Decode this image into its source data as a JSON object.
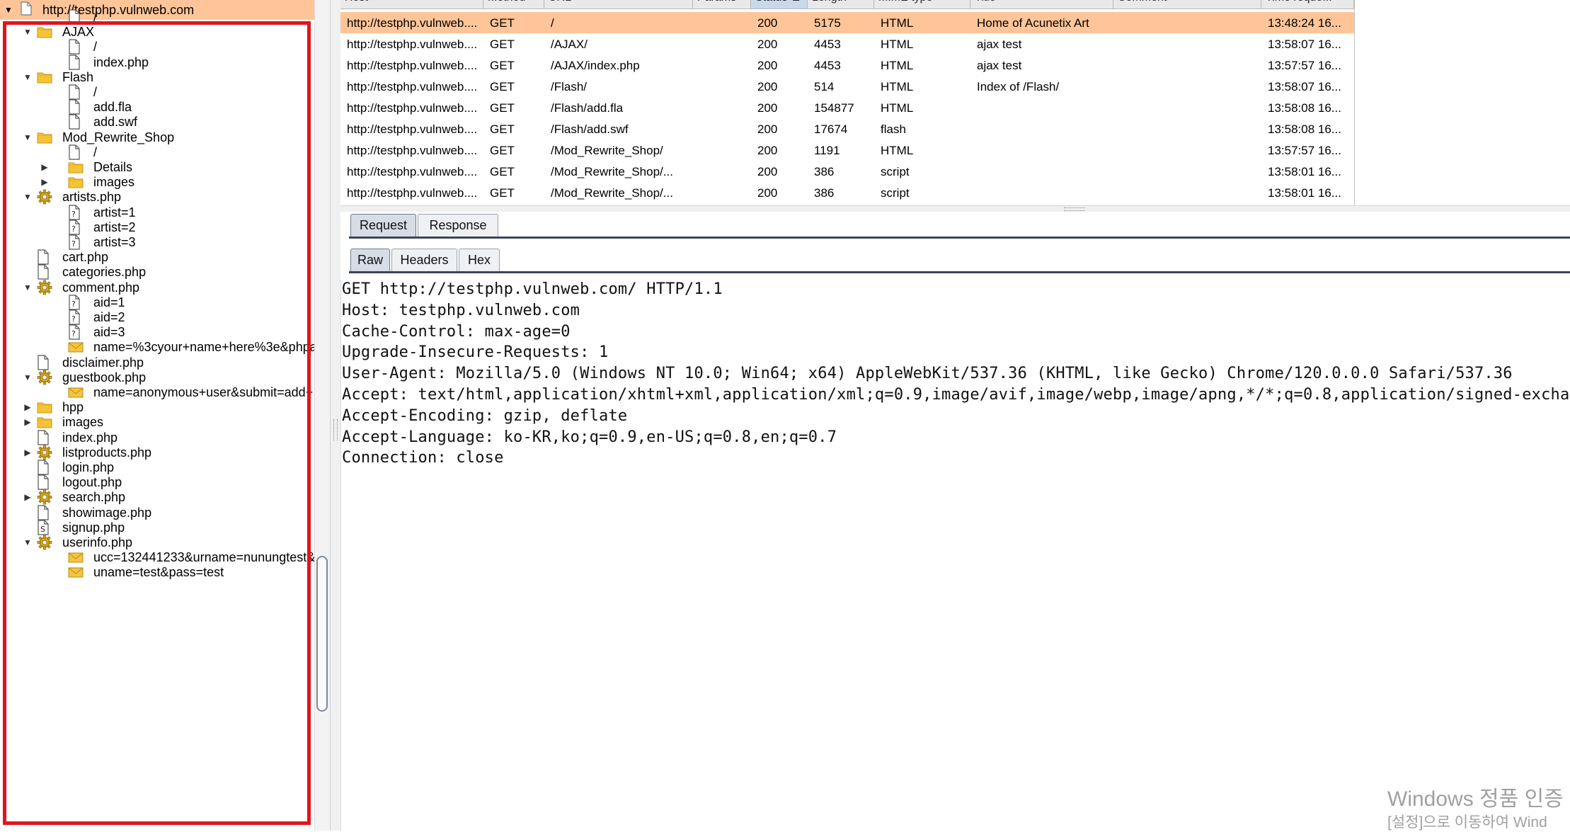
{
  "colors": {
    "selection": "#ffc599",
    "highlight_border": "#e1141e",
    "folder": "#f6c335",
    "gear": "#d4a21e",
    "envelope": "#f5c542"
  },
  "site_tree": {
    "root": {
      "label": "http://testphp.vulnweb.com",
      "icon": "document-icon"
    },
    "items": [
      {
        "label": "/",
        "icon": "file-icon",
        "level": 1,
        "toggle": ""
      },
      {
        "label": "AJAX",
        "icon": "folder-icon",
        "level": 0,
        "toggle": "▼"
      },
      {
        "label": "/",
        "icon": "file-icon",
        "level": 1,
        "toggle": ""
      },
      {
        "label": "index.php",
        "icon": "file-icon",
        "level": 1,
        "toggle": ""
      },
      {
        "label": "Flash",
        "icon": "folder-icon",
        "level": 0,
        "toggle": "▼"
      },
      {
        "label": "/",
        "icon": "file-icon",
        "level": 1,
        "toggle": ""
      },
      {
        "label": "add.fla",
        "icon": "file-icon",
        "level": 1,
        "toggle": ""
      },
      {
        "label": "add.swf",
        "icon": "file-icon",
        "level": 1,
        "toggle": ""
      },
      {
        "label": "Mod_Rewrite_Shop",
        "icon": "folder-icon",
        "level": 0,
        "toggle": "▼"
      },
      {
        "label": "/",
        "icon": "file-icon",
        "level": 1,
        "toggle": ""
      },
      {
        "label": "Details",
        "icon": "folder-icon",
        "level": 1,
        "toggle": "▶"
      },
      {
        "label": "images",
        "icon": "folder-icon",
        "level": 1,
        "toggle": "▶"
      },
      {
        "label": "artists.php",
        "icon": "gear-icon",
        "level": 0,
        "toggle": "▼"
      },
      {
        "label": "artist=1",
        "icon": "question-file-icon",
        "level": 1,
        "toggle": ""
      },
      {
        "label": "artist=2",
        "icon": "question-file-icon",
        "level": 1,
        "toggle": ""
      },
      {
        "label": "artist=3",
        "icon": "question-file-icon",
        "level": 1,
        "toggle": ""
      },
      {
        "label": "cart.php",
        "icon": "file-icon",
        "level": 0,
        "toggle": ""
      },
      {
        "label": "categories.php",
        "icon": "file-icon",
        "level": 0,
        "toggle": ""
      },
      {
        "label": "comment.php",
        "icon": "gear-icon",
        "level": 0,
        "toggle": "▼"
      },
      {
        "label": "aid=1",
        "icon": "question-file-icon",
        "level": 1,
        "toggle": ""
      },
      {
        "label": "aid=2",
        "icon": "question-file-icon",
        "level": 1,
        "toggle": ""
      },
      {
        "label": "aid=3",
        "icon": "question-file-icon",
        "level": 1,
        "toggle": ""
      },
      {
        "label": "name=%3cyour+name+here%3e&phpa",
        "icon": "envelope-icon",
        "level": 1,
        "toggle": ""
      },
      {
        "label": "disclaimer.php",
        "icon": "file-icon",
        "level": 0,
        "toggle": ""
      },
      {
        "label": "guestbook.php",
        "icon": "gear-icon",
        "level": 0,
        "toggle": "▼"
      },
      {
        "label": "name=anonymous+user&submit=add+",
        "icon": "envelope-icon",
        "level": 1,
        "toggle": ""
      },
      {
        "label": "hpp",
        "icon": "folder-icon",
        "level": 0,
        "toggle": "▶"
      },
      {
        "label": "images",
        "icon": "folder-icon",
        "level": 0,
        "toggle": "▶"
      },
      {
        "label": "index.php",
        "icon": "file-icon",
        "level": 0,
        "toggle": ""
      },
      {
        "label": "listproducts.php",
        "icon": "gear-icon",
        "level": 0,
        "toggle": "▶"
      },
      {
        "label": "login.php",
        "icon": "file-icon",
        "level": 0,
        "toggle": ""
      },
      {
        "label": "logout.php",
        "icon": "file-icon",
        "level": 0,
        "toggle": ""
      },
      {
        "label": "search.php",
        "icon": "gear-icon",
        "level": 0,
        "toggle": "▶"
      },
      {
        "label": "showimage.php",
        "icon": "file-icon",
        "level": 0,
        "toggle": ""
      },
      {
        "label": "signup.php",
        "icon": "script-file-icon",
        "level": 0,
        "toggle": ""
      },
      {
        "label": "userinfo.php",
        "icon": "gear-icon",
        "level": 0,
        "toggle": "▼"
      },
      {
        "label": "ucc=132441233&urname=nunungtest&",
        "icon": "envelope-icon",
        "level": 1,
        "toggle": ""
      },
      {
        "label": "uname=test&pass=test",
        "icon": "envelope-icon",
        "level": 1,
        "toggle": ""
      }
    ]
  },
  "history_table": {
    "columns": [
      {
        "label": "Host",
        "sorted": false
      },
      {
        "label": "Method",
        "sorted": false
      },
      {
        "label": "URL",
        "sorted": false
      },
      {
        "label": "Params",
        "sorted": false
      },
      {
        "label": "Status ▲",
        "sorted": true
      },
      {
        "label": "Length",
        "sorted": false
      },
      {
        "label": "MIME type",
        "sorted": false
      },
      {
        "label": "Title",
        "sorted": false
      },
      {
        "label": "Comment",
        "sorted": false
      },
      {
        "label": "Time reque...",
        "sorted": false
      }
    ],
    "rows": [
      {
        "host": "http://testphp.vulnweb....",
        "method": "GET",
        "url": "/",
        "status": "200",
        "length": "5175",
        "mime": "HTML",
        "title": "Home of Acunetix Art",
        "time": "13:48:24 16...",
        "selected": true
      },
      {
        "host": "http://testphp.vulnweb....",
        "method": "GET",
        "url": "/AJAX/",
        "status": "200",
        "length": "4453",
        "mime": "HTML",
        "title": "ajax test",
        "time": "13:58:07 16...",
        "selected": false
      },
      {
        "host": "http://testphp.vulnweb....",
        "method": "GET",
        "url": "/AJAX/index.php",
        "status": "200",
        "length": "4453",
        "mime": "HTML",
        "title": "ajax test",
        "time": "13:57:57 16...",
        "selected": false
      },
      {
        "host": "http://testphp.vulnweb....",
        "method": "GET",
        "url": "/Flash/",
        "status": "200",
        "length": "514",
        "mime": "HTML",
        "title": "Index of /Flash/",
        "time": "13:58:07 16...",
        "selected": false
      },
      {
        "host": "http://testphp.vulnweb....",
        "method": "GET",
        "url": "/Flash/add.fla",
        "status": "200",
        "length": "154877",
        "mime": "HTML",
        "title": "",
        "time": "13:58:08 16...",
        "selected": false
      },
      {
        "host": "http://testphp.vulnweb....",
        "method": "GET",
        "url": "/Flash/add.swf",
        "status": "200",
        "length": "17674",
        "mime": "flash",
        "title": "",
        "time": "13:58:08 16...",
        "selected": false
      },
      {
        "host": "http://testphp.vulnweb....",
        "method": "GET",
        "url": "/Mod_Rewrite_Shop/",
        "status": "200",
        "length": "1191",
        "mime": "HTML",
        "title": "",
        "time": "13:57:57 16...",
        "selected": false
      },
      {
        "host": "http://testphp.vulnweb....",
        "method": "GET",
        "url": "/Mod_Rewrite_Shop/...",
        "status": "200",
        "length": "386",
        "mime": "script",
        "title": "",
        "time": "13:58:01 16...",
        "selected": false
      },
      {
        "host": "http://testphp.vulnweb....",
        "method": "GET",
        "url": "/Mod_Rewrite_Shop/...",
        "status": "200",
        "length": "386",
        "mime": "script",
        "title": "",
        "time": "13:58:01 16...",
        "selected": false
      }
    ]
  },
  "message_tabs": {
    "tabs": [
      {
        "label": "Request",
        "active": true
      },
      {
        "label": "Response",
        "active": false
      }
    ]
  },
  "view_tabs": {
    "tabs": [
      {
        "label": "Raw",
        "active": true
      },
      {
        "label": "Headers",
        "active": false
      },
      {
        "label": "Hex",
        "active": false
      }
    ]
  },
  "raw_request": {
    "lines": [
      "GET http://testphp.vulnweb.com/ HTTP/1.1",
      "Host: testphp.vulnweb.com",
      "Cache-Control: max-age=0",
      "Upgrade-Insecure-Requests: 1",
      "User-Agent: Mozilla/5.0 (Windows NT 10.0; Win64; x64) AppleWebKit/537.36 (KHTML, like Gecko) Chrome/120.0.0.0 Safari/537.36",
      "Accept: text/html,application/xhtml+xml,application/xml;q=0.9,image/avif,image/webp,image/apng,*/*;q=0.8,application/signed-excha",
      "Accept-Encoding: gzip, deflate",
      "Accept-Language: ko-KR,ko;q=0.9,en-US;q=0.8,en;q=0.7",
      "Connection: close"
    ]
  },
  "watermark": {
    "line1": "Windows 정품 인증",
    "line2": "[설정]으로 이동하여 Wind"
  }
}
